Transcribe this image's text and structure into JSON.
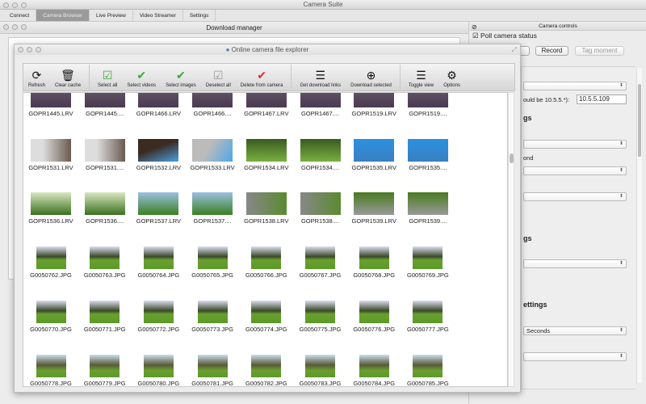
{
  "app": {
    "title": "Camera Suite"
  },
  "tabs": [
    {
      "label": "Connect"
    },
    {
      "label": "Camera Browser",
      "active": true
    },
    {
      "label": "Live Preview"
    },
    {
      "label": "Video Streamer"
    },
    {
      "label": "Settings"
    }
  ],
  "download_manager": {
    "title": "Download manager"
  },
  "camera_controls": {
    "title": "Camera controls",
    "poll_label": "Poll camera status",
    "poll_checked": true,
    "record_label": "Record",
    "tag_label": "Tag moment",
    "ip_label": "ould be 10.5.5.*):",
    "ip_value": "10.5.5.109",
    "heading1": "gs",
    "label_ond": "ond",
    "heading2": "gs",
    "heading3": "ettings",
    "select_seconds": "Seconds"
  },
  "explorer": {
    "title": "Online camera file explorer",
    "toolbar": [
      {
        "label": "Refresh",
        "icon": "refresh-icon"
      },
      {
        "label": "Clear cache",
        "icon": "trash-icon"
      },
      {
        "label": "Select all",
        "icon": "checkbox-checked-icon"
      },
      {
        "label": "Select videos",
        "icon": "check-video-icon"
      },
      {
        "label": "Select images",
        "icon": "check-image-icon"
      },
      {
        "label": "Deselect all",
        "icon": "checkbox-grey-icon"
      },
      {
        "label": "Delete from camera",
        "icon": "check-delete-icon"
      },
      {
        "label": "Get download links",
        "icon": "list-icon"
      },
      {
        "label": "Download selected",
        "icon": "download-icon"
      },
      {
        "label": "Toggle view",
        "icon": "list-icon"
      },
      {
        "label": "Options",
        "icon": "gear-icon"
      }
    ],
    "files": [
      [
        "GOPR1445.LRV",
        "GOPR1445....",
        "GOPR1466.LRV",
        "GOPR1466....",
        "GOPR1467.LRV",
        "GOPR1467....",
        "GOPR1519.LRV",
        "GOPR1519...."
      ],
      [
        "GOPR1531.LRV",
        "GOPR1531....",
        "GOPR1532.LRV",
        "GOPR1533.LRV",
        "GOPR1534.LRV",
        "GOPR1534....",
        "GOPR1535.LRV",
        "GOPR1535...."
      ],
      [
        "GOPR1536.LRV",
        "GOPR1536....",
        "GOPR1537.LRV",
        "GOPR1537....",
        "GOPR1538.LRV",
        "GOPR1538....",
        "GOPR1539.LRV",
        "GOPR1539...."
      ],
      [
        "G0050762.JPG",
        "G0050763.JPG",
        "G0050764.JPG",
        "G0050765.JPG",
        "G0050766.JPG",
        "G0050767.JPG",
        "G0050768.JPG",
        "G0050769.JPG"
      ],
      [
        "G0050770.JPG",
        "G0050771.JPG",
        "G0050772.JPG",
        "G0050773.JPG",
        "G0050774.JPG",
        "G0050775.JPG",
        "G0050776.JPG",
        "G0050777.JPG"
      ],
      [
        "G0050778.JPG",
        "G0050779.JPG",
        "G0050780.JPG",
        "G0050781.JPG",
        "G0050782.JPG",
        "G0050783.JPG",
        "G0050784.JPG",
        "G0050785.JPG"
      ]
    ]
  },
  "colors": {
    "check_green": "#3aa83a",
    "delete_red": "#d83030"
  }
}
